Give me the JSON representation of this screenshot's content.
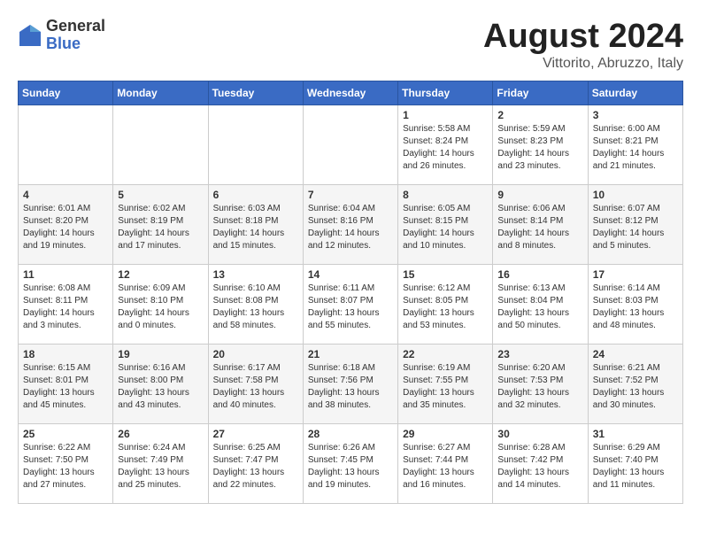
{
  "header": {
    "logo_general": "General",
    "logo_blue": "Blue",
    "month_year": "August 2024",
    "location": "Vittorito, Abruzzo, Italy"
  },
  "days_of_week": [
    "Sunday",
    "Monday",
    "Tuesday",
    "Wednesday",
    "Thursday",
    "Friday",
    "Saturday"
  ],
  "weeks": [
    [
      {
        "num": "",
        "info": ""
      },
      {
        "num": "",
        "info": ""
      },
      {
        "num": "",
        "info": ""
      },
      {
        "num": "",
        "info": ""
      },
      {
        "num": "1",
        "info": "Sunrise: 5:58 AM\nSunset: 8:24 PM\nDaylight: 14 hours\nand 26 minutes."
      },
      {
        "num": "2",
        "info": "Sunrise: 5:59 AM\nSunset: 8:23 PM\nDaylight: 14 hours\nand 23 minutes."
      },
      {
        "num": "3",
        "info": "Sunrise: 6:00 AM\nSunset: 8:21 PM\nDaylight: 14 hours\nand 21 minutes."
      }
    ],
    [
      {
        "num": "4",
        "info": "Sunrise: 6:01 AM\nSunset: 8:20 PM\nDaylight: 14 hours\nand 19 minutes."
      },
      {
        "num": "5",
        "info": "Sunrise: 6:02 AM\nSunset: 8:19 PM\nDaylight: 14 hours\nand 17 minutes."
      },
      {
        "num": "6",
        "info": "Sunrise: 6:03 AM\nSunset: 8:18 PM\nDaylight: 14 hours\nand 15 minutes."
      },
      {
        "num": "7",
        "info": "Sunrise: 6:04 AM\nSunset: 8:16 PM\nDaylight: 14 hours\nand 12 minutes."
      },
      {
        "num": "8",
        "info": "Sunrise: 6:05 AM\nSunset: 8:15 PM\nDaylight: 14 hours\nand 10 minutes."
      },
      {
        "num": "9",
        "info": "Sunrise: 6:06 AM\nSunset: 8:14 PM\nDaylight: 14 hours\nand 8 minutes."
      },
      {
        "num": "10",
        "info": "Sunrise: 6:07 AM\nSunset: 8:12 PM\nDaylight: 14 hours\nand 5 minutes."
      }
    ],
    [
      {
        "num": "11",
        "info": "Sunrise: 6:08 AM\nSunset: 8:11 PM\nDaylight: 14 hours\nand 3 minutes."
      },
      {
        "num": "12",
        "info": "Sunrise: 6:09 AM\nSunset: 8:10 PM\nDaylight: 14 hours\nand 0 minutes."
      },
      {
        "num": "13",
        "info": "Sunrise: 6:10 AM\nSunset: 8:08 PM\nDaylight: 13 hours\nand 58 minutes."
      },
      {
        "num": "14",
        "info": "Sunrise: 6:11 AM\nSunset: 8:07 PM\nDaylight: 13 hours\nand 55 minutes."
      },
      {
        "num": "15",
        "info": "Sunrise: 6:12 AM\nSunset: 8:05 PM\nDaylight: 13 hours\nand 53 minutes."
      },
      {
        "num": "16",
        "info": "Sunrise: 6:13 AM\nSunset: 8:04 PM\nDaylight: 13 hours\nand 50 minutes."
      },
      {
        "num": "17",
        "info": "Sunrise: 6:14 AM\nSunset: 8:03 PM\nDaylight: 13 hours\nand 48 minutes."
      }
    ],
    [
      {
        "num": "18",
        "info": "Sunrise: 6:15 AM\nSunset: 8:01 PM\nDaylight: 13 hours\nand 45 minutes."
      },
      {
        "num": "19",
        "info": "Sunrise: 6:16 AM\nSunset: 8:00 PM\nDaylight: 13 hours\nand 43 minutes."
      },
      {
        "num": "20",
        "info": "Sunrise: 6:17 AM\nSunset: 7:58 PM\nDaylight: 13 hours\nand 40 minutes."
      },
      {
        "num": "21",
        "info": "Sunrise: 6:18 AM\nSunset: 7:56 PM\nDaylight: 13 hours\nand 38 minutes."
      },
      {
        "num": "22",
        "info": "Sunrise: 6:19 AM\nSunset: 7:55 PM\nDaylight: 13 hours\nand 35 minutes."
      },
      {
        "num": "23",
        "info": "Sunrise: 6:20 AM\nSunset: 7:53 PM\nDaylight: 13 hours\nand 32 minutes."
      },
      {
        "num": "24",
        "info": "Sunrise: 6:21 AM\nSunset: 7:52 PM\nDaylight: 13 hours\nand 30 minutes."
      }
    ],
    [
      {
        "num": "25",
        "info": "Sunrise: 6:22 AM\nSunset: 7:50 PM\nDaylight: 13 hours\nand 27 minutes."
      },
      {
        "num": "26",
        "info": "Sunrise: 6:24 AM\nSunset: 7:49 PM\nDaylight: 13 hours\nand 25 minutes."
      },
      {
        "num": "27",
        "info": "Sunrise: 6:25 AM\nSunset: 7:47 PM\nDaylight: 13 hours\nand 22 minutes."
      },
      {
        "num": "28",
        "info": "Sunrise: 6:26 AM\nSunset: 7:45 PM\nDaylight: 13 hours\nand 19 minutes."
      },
      {
        "num": "29",
        "info": "Sunrise: 6:27 AM\nSunset: 7:44 PM\nDaylight: 13 hours\nand 16 minutes."
      },
      {
        "num": "30",
        "info": "Sunrise: 6:28 AM\nSunset: 7:42 PM\nDaylight: 13 hours\nand 14 minutes."
      },
      {
        "num": "31",
        "info": "Sunrise: 6:29 AM\nSunset: 7:40 PM\nDaylight: 13 hours\nand 11 minutes."
      }
    ]
  ]
}
